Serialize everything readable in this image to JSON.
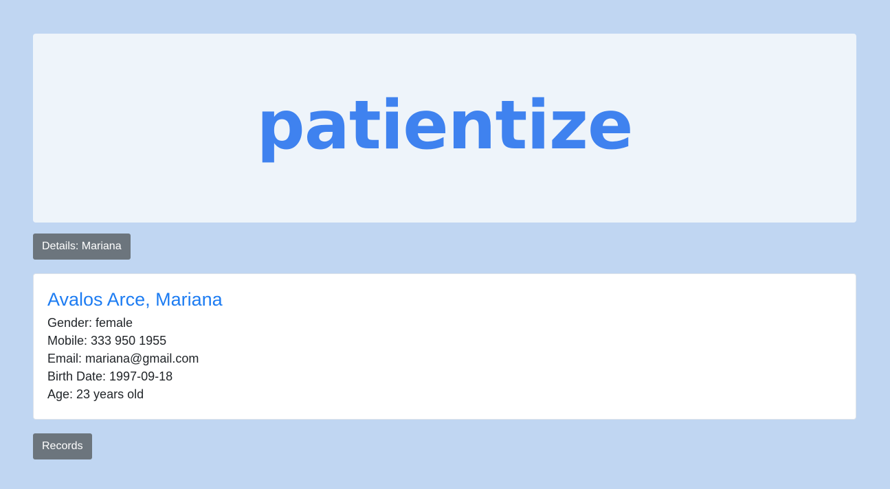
{
  "logo": {
    "text": "patientize"
  },
  "details_button": {
    "label": "Details: Mariana"
  },
  "patient": {
    "name": "Avalos Arce, Mariana",
    "fields": [
      "Gender: female",
      "Mobile: 333 950 1955",
      "Email: mariana@gmail.com",
      "Birth Date: 1997-09-18",
      "Age: 23 years old"
    ]
  },
  "records_button": {
    "label": "Records"
  },
  "colors": {
    "background": "#c0d6f2",
    "logo": "#3f82ef",
    "name": "#1d7cf2",
    "button": "#6c757d"
  }
}
